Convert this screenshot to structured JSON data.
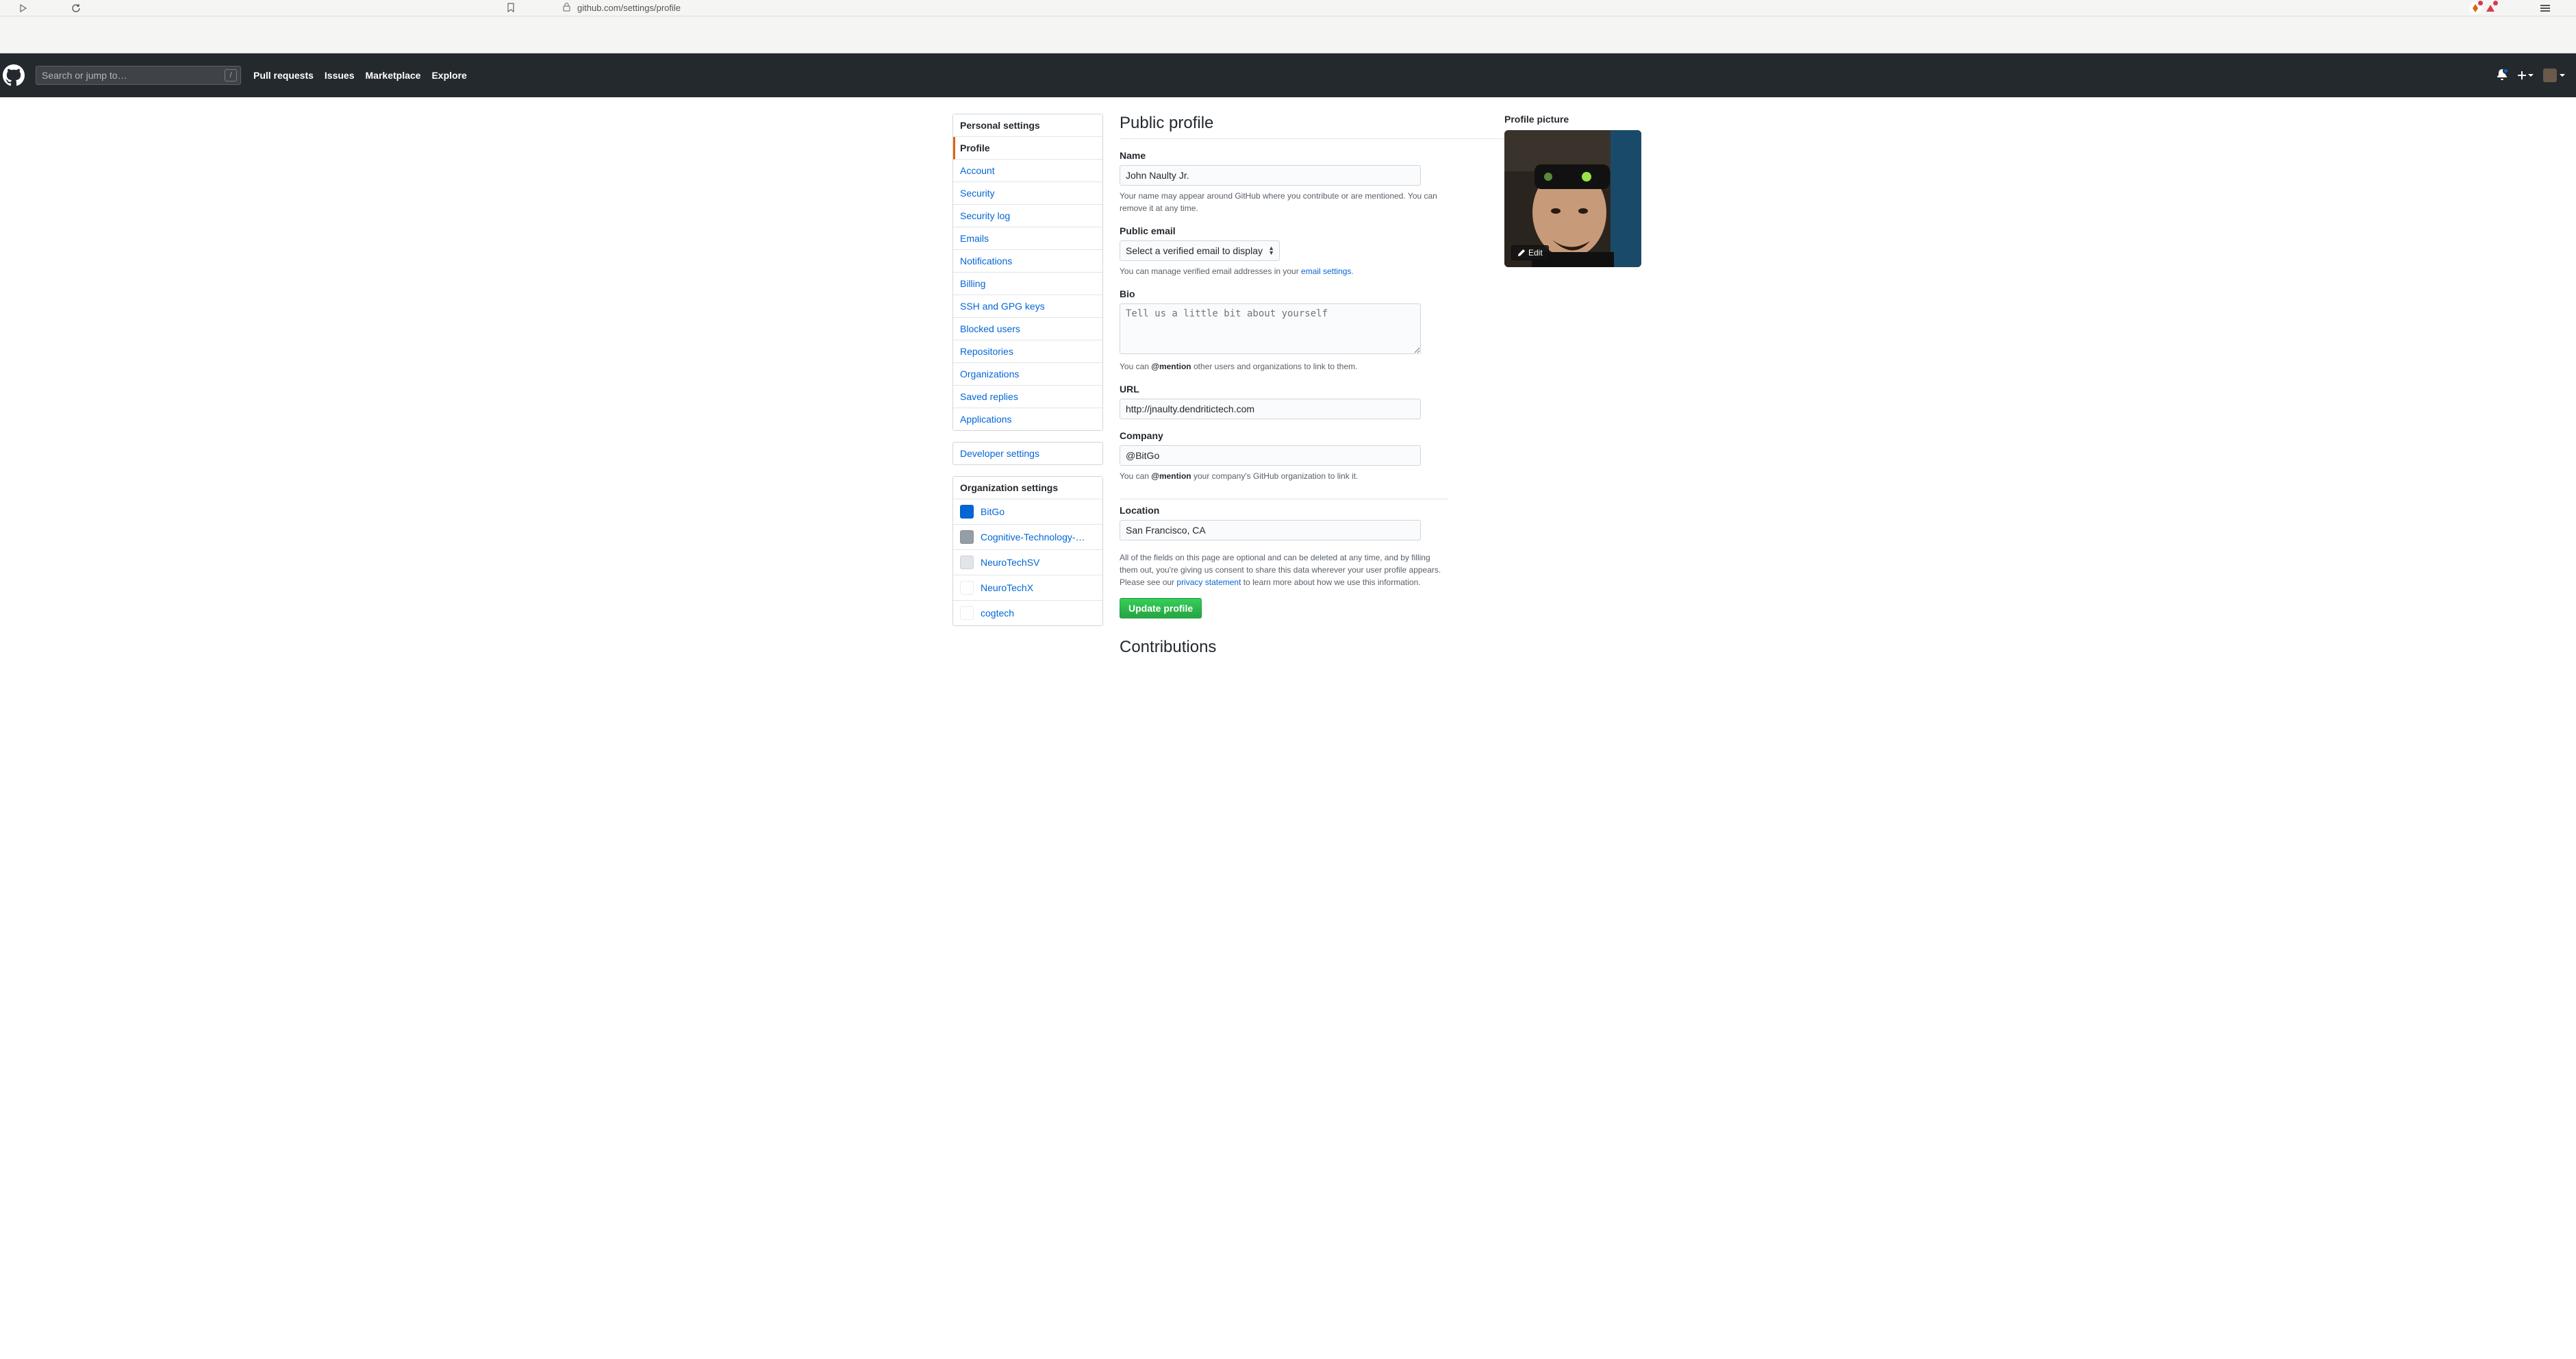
{
  "browser": {
    "url": "github.com/settings/profile"
  },
  "header": {
    "search_placeholder": "Search or jump to…",
    "slash_key": "/",
    "nav": {
      "pulls": "Pull requests",
      "issues": "Issues",
      "marketplace": "Marketplace",
      "explore": "Explore"
    }
  },
  "sidebar": {
    "personal_heading": "Personal settings",
    "items": [
      {
        "label": "Profile",
        "selected": true
      },
      {
        "label": "Account"
      },
      {
        "label": "Security"
      },
      {
        "label": "Security log"
      },
      {
        "label": "Emails"
      },
      {
        "label": "Notifications"
      },
      {
        "label": "Billing"
      },
      {
        "label": "SSH and GPG keys"
      },
      {
        "label": "Blocked users"
      },
      {
        "label": "Repositories"
      },
      {
        "label": "Organizations"
      },
      {
        "label": "Saved replies"
      },
      {
        "label": "Applications"
      }
    ],
    "dev_settings": "Developer settings",
    "org_heading": "Organization settings",
    "orgs": [
      {
        "label": "BitGo"
      },
      {
        "label": "Cognitive-Technology-…"
      },
      {
        "label": "NeuroTechSV"
      },
      {
        "label": "NeuroTechX"
      },
      {
        "label": "cogtech"
      }
    ]
  },
  "profile": {
    "heading": "Public profile",
    "name_label": "Name",
    "name_value": "John Naulty Jr.",
    "name_note": "Your name may appear around GitHub where you contribute or are mentioned. You can remove it at any time.",
    "email_label": "Public email",
    "email_selected": "Select a verified email to display",
    "email_note_pre": "You can manage verified email addresses in your ",
    "email_note_link": "email settings",
    "email_note_post": ".",
    "bio_label": "Bio",
    "bio_placeholder": "Tell us a little bit about yourself",
    "bio_note_pre": "You can ",
    "bio_note_strong": "@mention",
    "bio_note_post": " other users and organizations to link to them.",
    "url_label": "URL",
    "url_value": "http://jnaulty.dendritictech.com",
    "company_label": "Company",
    "company_value": "@BitGo",
    "company_note_pre": "You can ",
    "company_note_strong": "@mention",
    "company_note_post": " your company's GitHub organization to link it.",
    "location_label": "Location",
    "location_value": "San Francisco, CA",
    "disclaimer_pre": "All of the fields on this page are optional and can be deleted at any time, and by filling them out, you're giving us consent to share this data wherever your user profile appears. Please see our ",
    "disclaimer_link": "privacy statement",
    "disclaimer_post": " to learn more about how we use this information.",
    "submit": "Update profile",
    "contrib_heading": "Contributions"
  },
  "picture": {
    "label": "Profile picture",
    "edit": "Edit"
  }
}
